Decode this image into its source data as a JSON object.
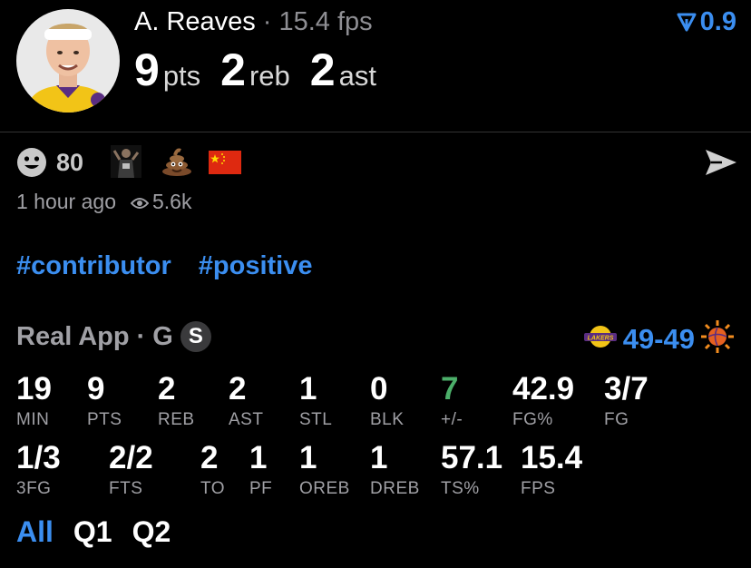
{
  "player": {
    "name": "A. Reaves",
    "fps": "15.4 fps",
    "stats": [
      {
        "num": "9",
        "unit": "pts"
      },
      {
        "num": "2",
        "unit": "reb"
      },
      {
        "num": "2",
        "unit": "ast"
      }
    ]
  },
  "rating": "0.9",
  "reactions": {
    "count": "80"
  },
  "meta": {
    "time": "1 hour ago",
    "views": "5.6k"
  },
  "tags": [
    "#contributor",
    "#positive"
  ],
  "game": {
    "source": "Real App",
    "position": "G",
    "badge": "S",
    "score": "49-49"
  },
  "stats_row1": [
    {
      "value": "19",
      "label": "MIN"
    },
    {
      "value": "9",
      "label": "PTS"
    },
    {
      "value": "2",
      "label": "REB"
    },
    {
      "value": "2",
      "label": "AST"
    },
    {
      "value": "1",
      "label": "STL"
    },
    {
      "value": "0",
      "label": "BLK"
    },
    {
      "value": "7",
      "label": "+/-"
    },
    {
      "value": "42.9",
      "label": "FG%"
    },
    {
      "value": "3/7",
      "label": "FG"
    }
  ],
  "stats_row2": [
    {
      "value": "1/3",
      "label": "3FG"
    },
    {
      "value": "2/2",
      "label": "FTS"
    },
    {
      "value": "2",
      "label": "TO"
    },
    {
      "value": "1",
      "label": "PF"
    },
    {
      "value": "1",
      "label": "OREB"
    },
    {
      "value": "1",
      "label": "DREB"
    },
    {
      "value": "57.1",
      "label": "TS%"
    },
    {
      "value": "15.4",
      "label": "FPS"
    }
  ],
  "periods": [
    "All",
    "Q1",
    "Q2"
  ],
  "colors": {
    "accent": "#3b8ef0",
    "positive": "#4caf6a",
    "muted": "#a0a0a5"
  },
  "icons": [
    "avatar-headshot",
    "rating-arrow-icon",
    "smiley-icon",
    "player-reaction-icon",
    "poop-icon",
    "china-flag-icon",
    "send-icon",
    "eye-icon",
    "lakers-logo",
    "suns-logo"
  ]
}
